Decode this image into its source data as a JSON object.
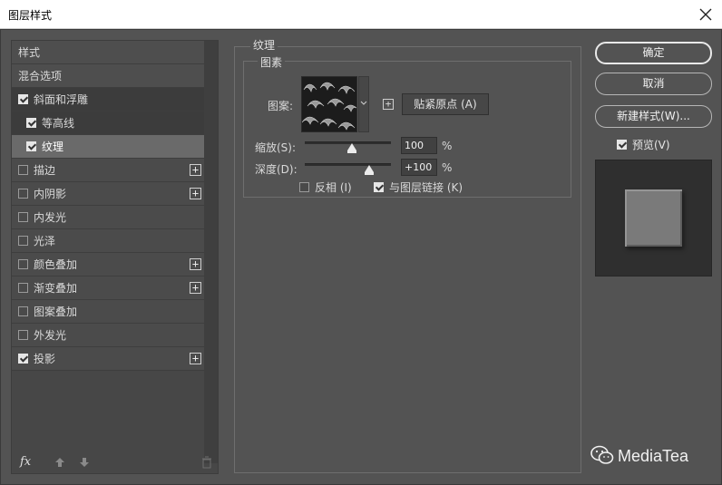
{
  "window": {
    "title": "图层样式"
  },
  "sidebar": {
    "items": [
      {
        "label": "样式",
        "checkbox": false,
        "checked": false,
        "plus": false
      },
      {
        "label": "混合选项",
        "checkbox": false,
        "checked": false,
        "plus": false
      },
      {
        "label": "斜面和浮雕",
        "checkbox": true,
        "checked": true,
        "plus": false
      },
      {
        "label": "等高线",
        "checkbox": true,
        "checked": true,
        "plus": false
      },
      {
        "label": "纹理",
        "checkbox": true,
        "checked": true,
        "plus": false
      },
      {
        "label": "描边",
        "checkbox": true,
        "checked": false,
        "plus": true
      },
      {
        "label": "内阴影",
        "checkbox": true,
        "checked": false,
        "plus": true
      },
      {
        "label": "内发光",
        "checkbox": true,
        "checked": false,
        "plus": false
      },
      {
        "label": "光泽",
        "checkbox": true,
        "checked": false,
        "plus": false
      },
      {
        "label": "颜色叠加",
        "checkbox": true,
        "checked": false,
        "plus": true
      },
      {
        "label": "渐变叠加",
        "checkbox": true,
        "checked": false,
        "plus": true
      },
      {
        "label": "图案叠加",
        "checkbox": true,
        "checked": false,
        "plus": false
      },
      {
        "label": "外发光",
        "checkbox": true,
        "checked": false,
        "plus": false
      },
      {
        "label": "投影",
        "checkbox": true,
        "checked": true,
        "plus": true
      }
    ],
    "fx_label": "fx"
  },
  "texture": {
    "section_title": "纹理",
    "group_title": "图素",
    "pattern_label": "图案:",
    "snap_button": "贴紧原点 (A)",
    "scale_label": "缩放(S):",
    "scale_value": "100",
    "scale_percent": 0.55,
    "depth_label": "深度(D):",
    "depth_value": "+100",
    "depth_percent": 0.75,
    "percent_sign": "%",
    "invert_label": "反相 (I)",
    "invert_checked": false,
    "link_label": "与图层链接 (K)",
    "link_checked": true
  },
  "buttons": {
    "ok": "确定",
    "cancel": "取消",
    "new_style": "新建样式(W)...",
    "preview_label": "预览(V)",
    "preview_checked": true
  },
  "brand": {
    "text": "MediaTea"
  }
}
